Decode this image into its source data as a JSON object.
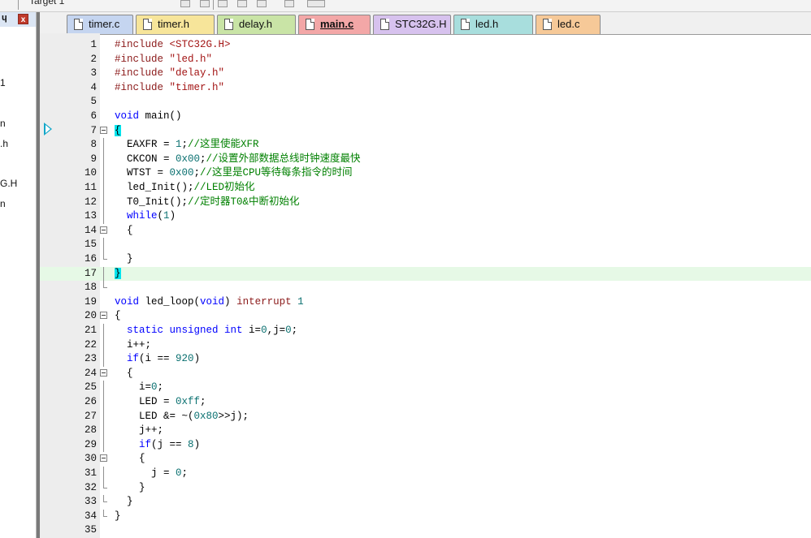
{
  "toolbar": {
    "target": "Target 1"
  },
  "panel": {
    "items": [
      "1",
      "n",
      ".h",
      "G.H",
      "n"
    ]
  },
  "tabs": [
    {
      "label": "timer.c",
      "color": "#c5d5f0"
    },
    {
      "label": "timer.h",
      "color": "#f7e59a"
    },
    {
      "label": "delay.h",
      "color": "#c9e4a6"
    },
    {
      "label": "main.c",
      "color": "#f3a7a7",
      "active": true
    },
    {
      "label": "STC32G.H",
      "color": "#d7c2ee"
    },
    {
      "label": "led.h",
      "color": "#a8dedd"
    },
    {
      "label": "led.c",
      "color": "#f6c998"
    }
  ],
  "editor": {
    "current_line": 17,
    "lines": [
      {
        "n": "1",
        "fold": "",
        "tokens": [
          [
            "pp",
            "#include "
          ],
          [
            "str",
            "<STC32G.H>"
          ]
        ]
      },
      {
        "n": "2",
        "fold": "",
        "tokens": [
          [
            "pp",
            "#include "
          ],
          [
            "str",
            "\"led.h\""
          ]
        ]
      },
      {
        "n": "3",
        "fold": "",
        "tokens": [
          [
            "pp",
            "#include "
          ],
          [
            "str",
            "\"delay.h\""
          ]
        ]
      },
      {
        "n": "4",
        "fold": "",
        "tokens": [
          [
            "pp",
            "#include "
          ],
          [
            "str",
            "\"timer.h\""
          ]
        ]
      },
      {
        "n": "5",
        "fold": "",
        "tokens": []
      },
      {
        "n": "6",
        "fold": "",
        "tokens": [
          [
            "kw",
            "void"
          ],
          [
            "t",
            " main()"
          ]
        ]
      },
      {
        "n": "7",
        "fold": "box",
        "tokens": [
          [
            "bh",
            "{"
          ]
        ]
      },
      {
        "n": "8",
        "fold": "line",
        "tokens": [
          [
            "t",
            "  EAXFR = "
          ],
          [
            "num",
            "1"
          ],
          [
            "t",
            ";"
          ],
          [
            "cm",
            "//这里使能XFR"
          ]
        ]
      },
      {
        "n": "9",
        "fold": "line",
        "tokens": [
          [
            "t",
            "  CKCON = "
          ],
          [
            "num",
            "0x00"
          ],
          [
            "t",
            ";"
          ],
          [
            "cm",
            "//设置外部数据总线时钟速度最快"
          ]
        ]
      },
      {
        "n": "10",
        "fold": "line",
        "tokens": [
          [
            "t",
            "  WTST = "
          ],
          [
            "num",
            "0x00"
          ],
          [
            "t",
            ";"
          ],
          [
            "cm",
            "//这里是CPU等待每条指令的时间"
          ]
        ]
      },
      {
        "n": "11",
        "fold": "line",
        "tokens": [
          [
            "t",
            "  led_Init();"
          ],
          [
            "cm",
            "//LED初始化"
          ]
        ]
      },
      {
        "n": "12",
        "fold": "line",
        "tokens": [
          [
            "t",
            "  T0_Init();"
          ],
          [
            "cm",
            "//定时器T0&中断初始化"
          ]
        ]
      },
      {
        "n": "13",
        "fold": "line",
        "tokens": [
          [
            "t",
            "  "
          ],
          [
            "kw",
            "while"
          ],
          [
            "t",
            "("
          ],
          [
            "num",
            "1"
          ],
          [
            "t",
            ")"
          ]
        ]
      },
      {
        "n": "14",
        "fold": "box",
        "tokens": [
          [
            "t",
            "  {"
          ]
        ]
      },
      {
        "n": "15",
        "fold": "line",
        "tokens": []
      },
      {
        "n": "16",
        "fold": "end",
        "tokens": [
          [
            "t",
            "  }"
          ]
        ]
      },
      {
        "n": "17",
        "fold": "line",
        "tokens": [
          [
            "bh",
            "}"
          ]
        ]
      },
      {
        "n": "18",
        "fold": "end",
        "tokens": []
      },
      {
        "n": "19",
        "fold": "",
        "tokens": [
          [
            "kw",
            "void"
          ],
          [
            "t",
            " led_loop("
          ],
          [
            "kw",
            "void"
          ],
          [
            "t",
            ") "
          ],
          [
            "pp",
            "interrupt"
          ],
          [
            "t",
            " "
          ],
          [
            "num",
            "1"
          ]
        ]
      },
      {
        "n": "20",
        "fold": "box",
        "tokens": [
          [
            "t",
            "{"
          ]
        ]
      },
      {
        "n": "21",
        "fold": "line",
        "tokens": [
          [
            "t",
            "  "
          ],
          [
            "kw",
            "static unsigned int"
          ],
          [
            "t",
            " i="
          ],
          [
            "num",
            "0"
          ],
          [
            "t",
            ",j="
          ],
          [
            "num",
            "0"
          ],
          [
            "t",
            ";"
          ]
        ]
      },
      {
        "n": "22",
        "fold": "line",
        "tokens": [
          [
            "t",
            "  i++;"
          ]
        ]
      },
      {
        "n": "23",
        "fold": "line",
        "tokens": [
          [
            "t",
            "  "
          ],
          [
            "kw",
            "if"
          ],
          [
            "t",
            "(i == "
          ],
          [
            "num",
            "920"
          ],
          [
            "t",
            ")"
          ]
        ]
      },
      {
        "n": "24",
        "fold": "box",
        "tokens": [
          [
            "t",
            "  {"
          ]
        ]
      },
      {
        "n": "25",
        "fold": "line",
        "tokens": [
          [
            "t",
            "    i="
          ],
          [
            "num",
            "0"
          ],
          [
            "t",
            ";"
          ]
        ]
      },
      {
        "n": "26",
        "fold": "line",
        "tokens": [
          [
            "t",
            "    LED = "
          ],
          [
            "num",
            "0xff"
          ],
          [
            "t",
            ";"
          ]
        ]
      },
      {
        "n": "27",
        "fold": "line",
        "tokens": [
          [
            "t",
            "    LED &= ~("
          ],
          [
            "num",
            "0x80"
          ],
          [
            "t",
            ">>j);"
          ]
        ]
      },
      {
        "n": "28",
        "fold": "line",
        "tokens": [
          [
            "t",
            "    j++;"
          ]
        ]
      },
      {
        "n": "29",
        "fold": "line",
        "tokens": [
          [
            "t",
            "    "
          ],
          [
            "kw",
            "if"
          ],
          [
            "t",
            "(j == "
          ],
          [
            "num",
            "8"
          ],
          [
            "t",
            ")"
          ]
        ]
      },
      {
        "n": "30",
        "fold": "box",
        "tokens": [
          [
            "t",
            "    {"
          ]
        ]
      },
      {
        "n": "31",
        "fold": "line",
        "tokens": [
          [
            "t",
            "      j = "
          ],
          [
            "num",
            "0"
          ],
          [
            "t",
            ";"
          ]
        ]
      },
      {
        "n": "32",
        "fold": "end",
        "tokens": [
          [
            "t",
            "    }"
          ]
        ]
      },
      {
        "n": "33",
        "fold": "end",
        "tokens": [
          [
            "t",
            "  }"
          ]
        ]
      },
      {
        "n": "34",
        "fold": "end",
        "tokens": [
          [
            "t",
            "}"
          ]
        ]
      },
      {
        "n": "35",
        "fold": "",
        "tokens": []
      }
    ]
  }
}
